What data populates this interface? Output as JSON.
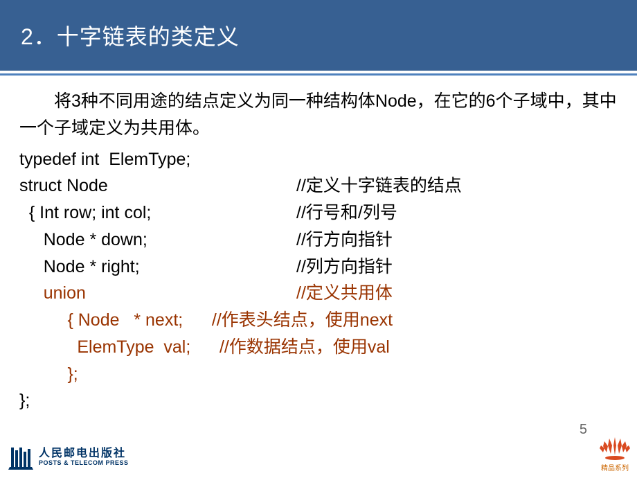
{
  "title": "2．十字链表的类定义",
  "intro": "将3种不同用途的结点定义为同一种结构体Node，在它的6个子域中，其中一个子域定义为共用体。",
  "code": {
    "l1_left": "typedef int  ElemType;",
    "l2_left": "struct Node",
    "l2_comment": "//定义十字链表的结点",
    "l3_left": "  { Int row; int col;",
    "l3_comment": "//行号和/列号",
    "l4_left": "     Node * down;",
    "l4_comment": "//行方向指针",
    "l5_left": "     Node * right;",
    "l5_comment": "//列方向指针",
    "l6_left": "     union",
    "l6_comment": "//定义共用体",
    "l7_left": "          { Node   * next;      ",
    "l7_comment": "//作表头结点，使用next",
    "l8_left": "            ElemType  val;      ",
    "l8_comment": "//作数据结点，使用val",
    "l9_left": "          };",
    "l10_left": "};"
  },
  "page_number": "5",
  "footer": {
    "publisher_cn": "人民邮电出版社",
    "publisher_en": "POSTS & TELECOM PRESS",
    "series": "精品系列"
  }
}
